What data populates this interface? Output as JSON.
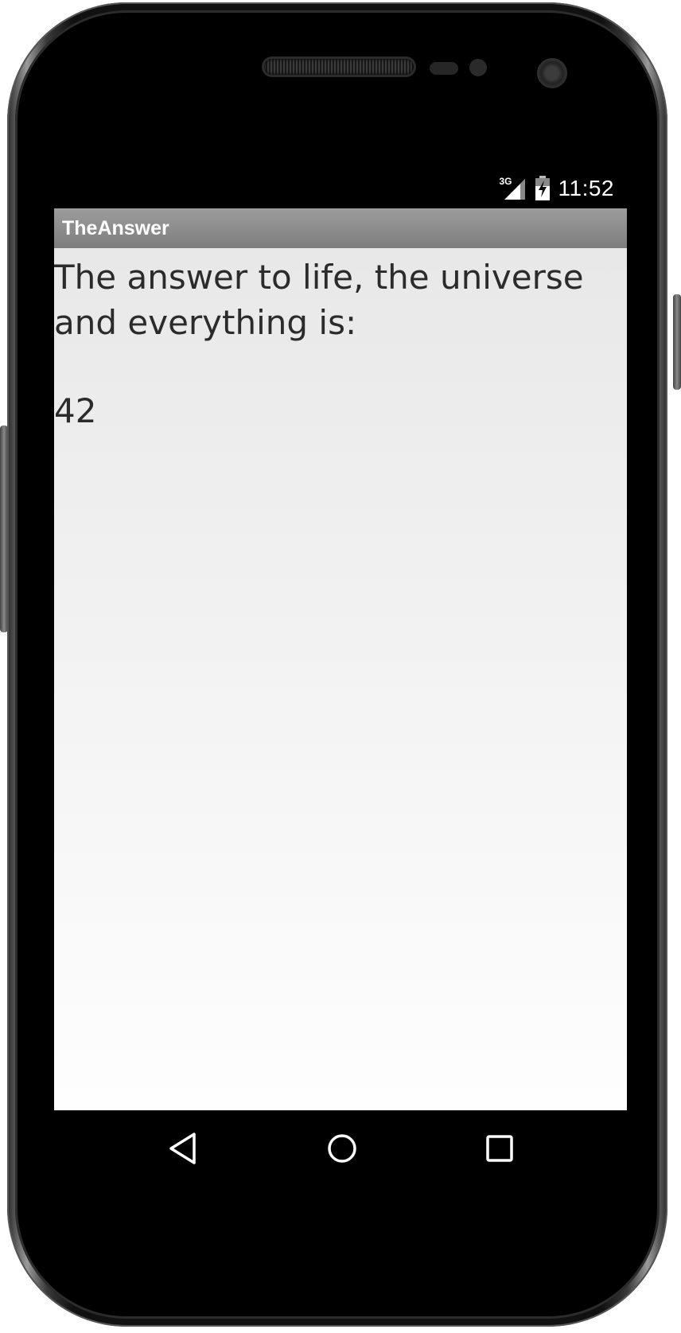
{
  "status_bar": {
    "network_type": "3G",
    "network_icon": "cell-signal-icon",
    "battery_icon": "battery-charging-icon",
    "time": "11:52"
  },
  "app": {
    "title": "TheAnswer"
  },
  "content": {
    "question": "The answer to life, the universe and everything is:",
    "answer": "42"
  },
  "nav_bar": {
    "back_icon": "back-icon",
    "home_icon": "home-icon",
    "recents_icon": "recents-icon"
  },
  "colors": {
    "action_bar": "#8c8c8c",
    "text": "#2b2b2b",
    "background_top": "#e8e8e8",
    "background_bottom": "#fefefe"
  }
}
